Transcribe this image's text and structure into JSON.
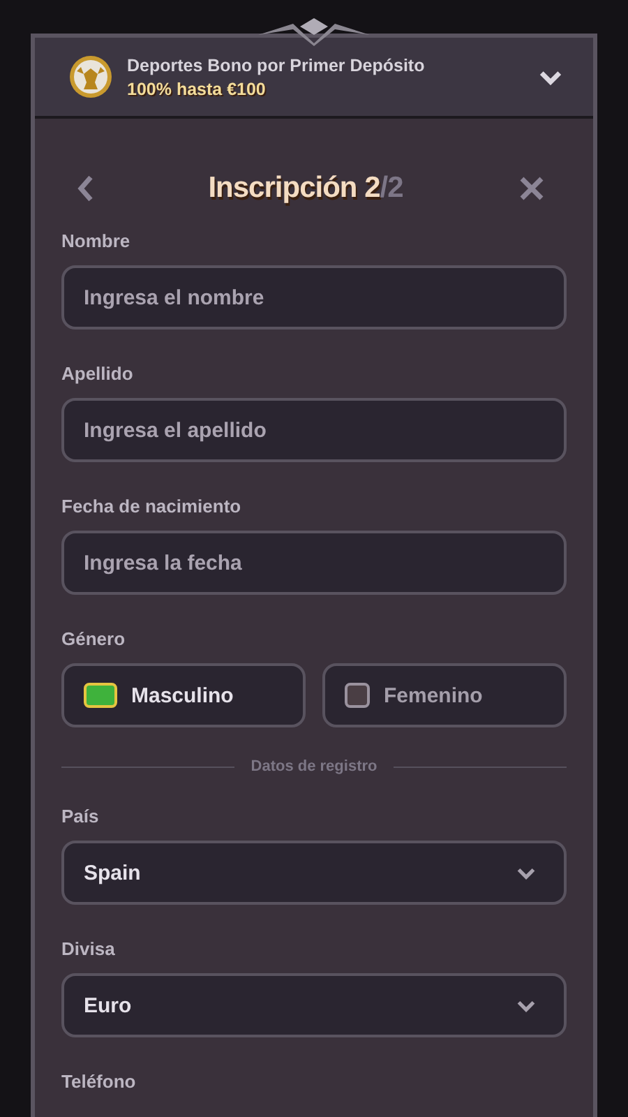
{
  "bonus_banner": {
    "title": "Deportes Bono por Primer Depósito",
    "subtitle": "100% hasta €100",
    "expanded": false
  },
  "header": {
    "title": "Inscripción 2",
    "step_total": "/2"
  },
  "fields": [
    {
      "label": "Nombre",
      "placeholder": "Ingresa el nombre"
    },
    {
      "label": "Apellido",
      "placeholder": "Ingresa el apellido"
    },
    {
      "label": "Fecha de nacimiento",
      "placeholder": "Ingresa la fecha"
    }
  ],
  "gender": {
    "label": "Género",
    "options": [
      {
        "label": "Masculino",
        "selected": true
      },
      {
        "label": "Femenino",
        "selected": false
      }
    ]
  },
  "section_divider": "Datos de registro",
  "selects": [
    {
      "label": "País",
      "value": "Spain"
    },
    {
      "label": "Divisa",
      "value": "Euro"
    }
  ],
  "phone": {
    "label": "Teléfono"
  }
}
